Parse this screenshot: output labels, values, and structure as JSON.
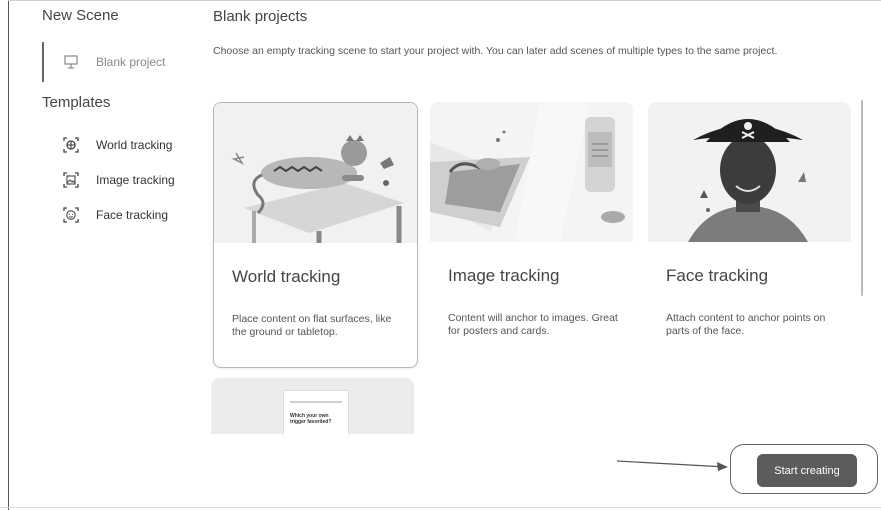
{
  "sidebar": {
    "new_scene_heading": "New Scene",
    "blank_item": {
      "label": "Blank project",
      "icon": "blank-project-icon"
    },
    "templates_heading": "Templates",
    "templates": [
      {
        "label": "World tracking",
        "icon": "world-tracking-icon"
      },
      {
        "label": "Image tracking",
        "icon": "image-tracking-icon"
      },
      {
        "label": "Face tracking",
        "icon": "face-tracking-icon"
      }
    ]
  },
  "main": {
    "title": "Blank projects",
    "description": "Choose an empty tracking scene to start your project with. You can later add scenes of multiple types to the same project.",
    "cards": [
      {
        "title": "World tracking",
        "description": "Place content on flat surfaces, like the ground or tabletop.",
        "selected": true
      },
      {
        "title": "Image tracking",
        "description": "Content will anchor to images. Great for posters and cards.",
        "selected": false
      },
      {
        "title": "Face tracking",
        "description": "Attach content to anchor points on parts of the face.",
        "selected": false
      }
    ],
    "partial_card": {
      "text": "Which your own trigger favorited?"
    }
  },
  "footer": {
    "start_button": "Start creating"
  }
}
